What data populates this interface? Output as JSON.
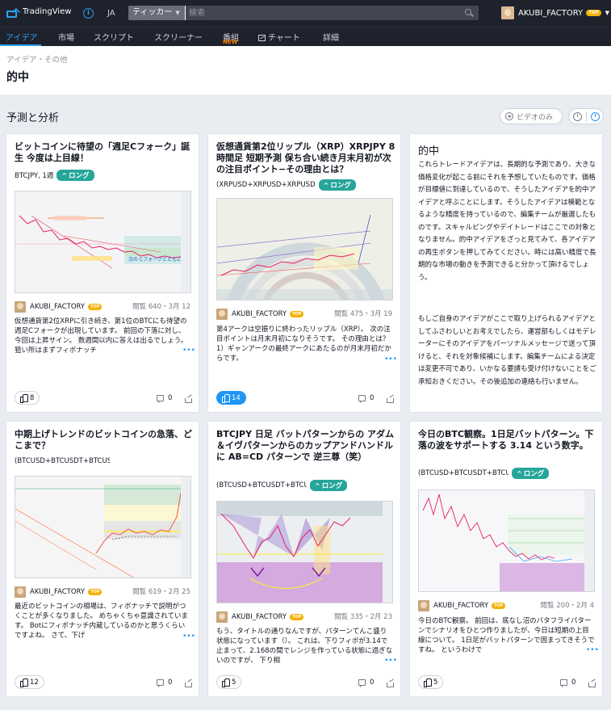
{
  "topbar": {
    "logo": "TradingView",
    "lang": "JA",
    "ticker_label": "ティッカー",
    "search_placeholder": "検索",
    "username": "AKUBI_FACTORY",
    "badge": "TOP"
  },
  "nav": {
    "items": [
      "アイデア",
      "市場",
      "スクリプト",
      "スクリーナー",
      "番組",
      "チャート",
      "詳細"
    ],
    "new_badge": "NEW"
  },
  "page": {
    "breadcrumb": "アイデア・その他",
    "title": "的中",
    "section_title": "予測と分析",
    "video_only": "ビデオのみ"
  },
  "accent_color": "#2196f3",
  "long_color": "#26a69a",
  "cards": [
    {
      "title": "ビットコインに待望の「週足Cフォーク」誕生 今度は上目線！",
      "symbol": "BTCJPY, 1週",
      "direction": "ロング",
      "author": "AKUBI_FACTORY",
      "author_badge": "TOP",
      "meta": "閲覧 640・3月 12",
      "desc": "仮想通貨第2位XRPに引き続き、第1位のBTCにも待望の週足Cフォークが出現しています。 前回の下落に対し、今回は上昇サイン。 数週間以内に答えは出るでしょう。 狙い所はまずフィボナッチ",
      "likes": "8",
      "comments": "0",
      "chart_note": "次の Cフォークとともに"
    },
    {
      "title": "仮想通貨第2位リップル（XRP）XRPJPY 8時間足 短期予測 保ち合い続き月末月初が次の注目ポイント−その理由とは？",
      "symbol": "(XRPUSD+XRPUSD+XRPUSD",
      "direction": "ロング",
      "author": "AKUBI_FACTORY",
      "author_badge": "TOP",
      "meta": "閲覧 475・3月 19",
      "desc": "第4アークは空振りに終わったリップル（XRP）。 次の注目ポイントは月末月初になりそうです。 その理由とは？ 1）ギャンアークの最終アークにあたるのが月末月初だからです。",
      "likes": "14",
      "comments": "0"
    },
    {
      "title": "中期上げトレンドのビットコインの急落、どこまで？",
      "symbol": "(BTCUSD+BTCUSDT+BTCUSD",
      "direction": "",
      "author": "AKUBI_FACTORY",
      "author_badge": "TOP",
      "meta": "閲覧 619・2月 25",
      "desc": "最近のビットコインの相場は、フィボナッチで説明がつくことが多くなりました。 めちゃくちゃ意識されています。 Botにフィボナッチ内蔵しているのかと思うくらいですよね。 さて、下げ",
      "likes": "12",
      "comments": "0"
    },
    {
      "title": "BTCJPY 日足 バットパターンからの アダム＆イヴパターンからのカップアンドハンドルに AB=CD パターンで 逆三尊（笑）",
      "symbol": "(BTCUSD+BTCUSDT+BTCUSD",
      "direction": "ロング",
      "author": "AKUBI_FACTORY",
      "author_badge": "TOP",
      "meta": "閲覧 335・2月 23",
      "desc": "もう、タイトルの通りなんですが、パターンてんこ盛り状態になっています（）。 これは、下りフィボが3.14で止まって、2.168の間でレンジを作っている状態に過ぎないのですが、 下り相",
      "likes": "5",
      "comments": "0"
    },
    {
      "title": "今日のBTC観察。1日足バットパターン。下落の波をサポートする 3.14 という数字。",
      "symbol": "(BTCUSD+BTCUSDT+BTCUSD",
      "direction": "ロング",
      "author": "AKUBI_FACTORY",
      "author_badge": "TOP",
      "meta": "閲覧 200・2月 4",
      "desc": "今日のBTC観察。 前回は、底なし沼のバタフライパターンでシナリオをひとつ作りましたが、今日は短期の上目線について。 1日足がバットパターンで固まってきそうですね。 というわけで",
      "likes": "5",
      "comments": "0"
    }
  ],
  "info_card": {
    "title": "的中",
    "para1": "これらトレードアイデアは、長期的な予測であり、大きな価格変化が起こる前にそれを予想していたものです。価格が目標値に到達しているので、そうしたアイデアを的中アイデアと呼ぶことにします。そうしたアイデアは模範となるような精度を持っているので、編集チームが厳選したものです。スキャルピングやデイトレードはここでの対象となりません。的中アイデアをざっと見てみて、各アイデアの再生ボタンを押してみてください。時には高い精度で長期的な市場の動きを予測できると分かって頂けるでしょう。",
    "para2": "もしご自身のアイデアがここで取り上げられるアイデアとしてふさわしいとお考えでしたら、運営部もしくはモデレーターにそのアイデアをパーソナルメッセージで送って頂けると、それを対象候補にします。編集チームによる決定は変更不可であり、いかなる要請も受け付けないことをご承知おきください。その後追加の連絡も行いません。"
  }
}
